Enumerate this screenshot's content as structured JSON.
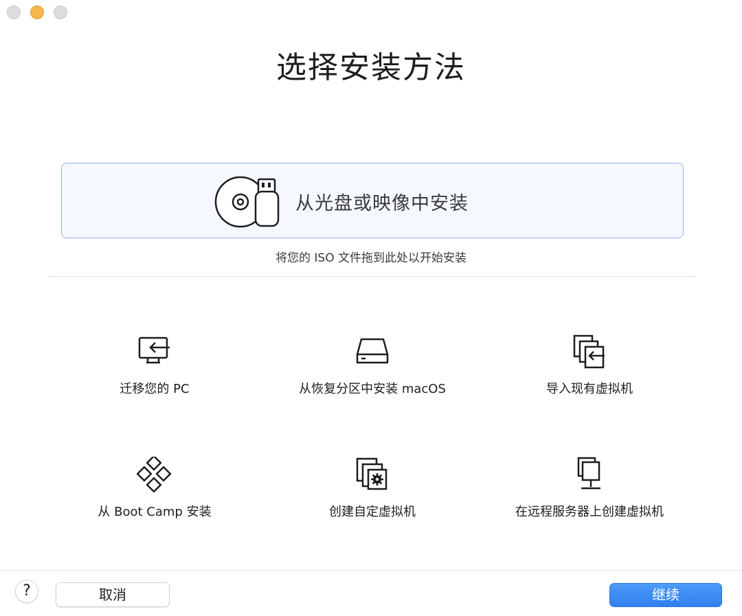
{
  "window": {
    "controls": [
      "close",
      "minimize",
      "zoom"
    ]
  },
  "title": "选择安装方法",
  "drop_zone": {
    "label": "从光盘或映像中安装",
    "hint": "将您的 ISO 文件拖到此处以开始安装",
    "icon": "disc-usb-icon"
  },
  "options": [
    {
      "label": "迁移您的 PC",
      "icon": "migrate-pc-icon"
    },
    {
      "label": "从恢复分区中安装 macOS",
      "icon": "disk-drive-icon"
    },
    {
      "label": "导入现有虚拟机",
      "icon": "import-vm-icon"
    },
    {
      "label": "从 Boot Camp 安装",
      "icon": "boot-camp-icon"
    },
    {
      "label": "创建自定虚拟机",
      "icon": "custom-vm-icon"
    },
    {
      "label": "在远程服务器上创建虚拟机",
      "icon": "remote-server-icon"
    }
  ],
  "footer": {
    "help_label": "?",
    "cancel_label": "取消",
    "continue_label": "继续"
  },
  "colors": {
    "accent": "#2f7ff1",
    "drop_zone_bg": "#f5f8fe",
    "drop_zone_border": "#8fb4f0",
    "minimize": "#f4b84a"
  }
}
